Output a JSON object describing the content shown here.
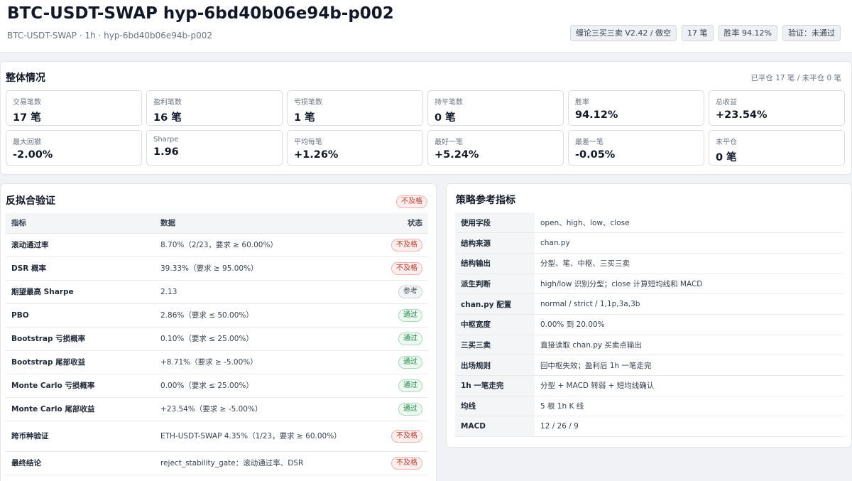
{
  "header": {
    "title": "BTC-USDT-SWAP hyp-6bd40b06e94b-p002",
    "subtitle": "BTC-USDT-SWAP · 1h · hyp-6bd40b06e94b-p002",
    "badges": [
      "缠论三买三卖 V2.42 / 做空",
      "17 笔",
      "胜率 94.12%",
      "验证：未通过"
    ]
  },
  "overview": {
    "title": "整体情况",
    "meta": "已平仓 17 笔 / 未平仓 0 笔",
    "stats": [
      {
        "label": "交易笔数",
        "value": "17 笔"
      },
      {
        "label": "盈利笔数",
        "value": "16 笔"
      },
      {
        "label": "亏损笔数",
        "value": "1 笔"
      },
      {
        "label": "持平笔数",
        "value": "0 笔"
      },
      {
        "label": "胜率",
        "value": "94.12%"
      },
      {
        "label": "总收益",
        "value": "+23.54%"
      },
      {
        "label": "最大回撤",
        "value": "-2.00%"
      },
      {
        "label": "Sharpe",
        "value": "1.96"
      },
      {
        "label": "平均每笔",
        "value": "+1.26%"
      },
      {
        "label": "最好一笔",
        "value": "+5.24%"
      },
      {
        "label": "最差一笔",
        "value": "-0.05%"
      },
      {
        "label": "未平仓",
        "value": "0 笔"
      }
    ]
  },
  "validation": {
    "title": "反拟合验证",
    "badge": "不及格",
    "columns": [
      "指标",
      "数据",
      "状态"
    ],
    "rows": [
      {
        "metric": "滚动通过率",
        "data": "8.70%（2/23，要求 ≥ 60.00%）",
        "status": "不及格",
        "kind": "fail"
      },
      {
        "metric": "DSR 概率",
        "data": "39.33%（要求 ≥ 95.00%）",
        "status": "不及格",
        "kind": "fail"
      },
      {
        "metric": "期望最高 Sharpe",
        "data": "2.13",
        "status": "参考",
        "kind": "ref"
      },
      {
        "metric": "PBO",
        "data": "2.86%（要求 ≤ 50.00%）",
        "status": "通过",
        "kind": "pass"
      },
      {
        "metric": "Bootstrap 亏损概率",
        "data": "0.10%（要求 ≤ 25.00%）",
        "status": "通过",
        "kind": "pass"
      },
      {
        "metric": "Bootstrap 尾部收益",
        "data": "+8.71%（要求 ≥ -5.00%）",
        "status": "通过",
        "kind": "pass"
      },
      {
        "metric": "Monte Carlo 亏损概率",
        "data": "0.00%（要求 ≤ 25.00%）",
        "status": "通过",
        "kind": "pass"
      },
      {
        "metric": "Monte Carlo 尾部收益",
        "data": "+23.54%（要求 ≥ -5.00%）",
        "status": "通过",
        "kind": "pass"
      },
      {
        "metric": "跨币种验证",
        "data": "ETH-USDT-SWAP 4.35%（1/23，要求 ≥ 60.00%）",
        "status": "不及格",
        "kind": "fail"
      },
      {
        "metric": "最终结论",
        "data": "reject_stability_gate：滚动通过率、DSR",
        "status": "不及格",
        "kind": "fail"
      }
    ]
  },
  "strategy": {
    "title": "策略参考指标",
    "rows": [
      {
        "key": "使用字段",
        "value": "open、high、low、close"
      },
      {
        "key": "结构来源",
        "value": "chan.py"
      },
      {
        "key": "结构输出",
        "value": "分型、笔、中枢、三买三卖"
      },
      {
        "key": "派生判断",
        "value": "high/low 识别分型；close 计算短均线和 MACD"
      },
      {
        "key": "chan.py 配置",
        "value": "normal / strict / 1,1p,3a,3b"
      },
      {
        "key": "中枢宽度",
        "value": "0.00% 到 20.00%"
      },
      {
        "key": "三买三卖",
        "value": "直接读取 chan.py 买卖点输出"
      },
      {
        "key": "出场规则",
        "value": "回中枢失效；盈利后 1h 一笔走完"
      },
      {
        "key": "1h 一笔走完",
        "value": "分型 + MACD 转弱 + 短均线确认"
      },
      {
        "key": "均线",
        "value": "5 根 1h K 线"
      },
      {
        "key": "MACD",
        "value": "12 / 26 / 9"
      }
    ]
  }
}
